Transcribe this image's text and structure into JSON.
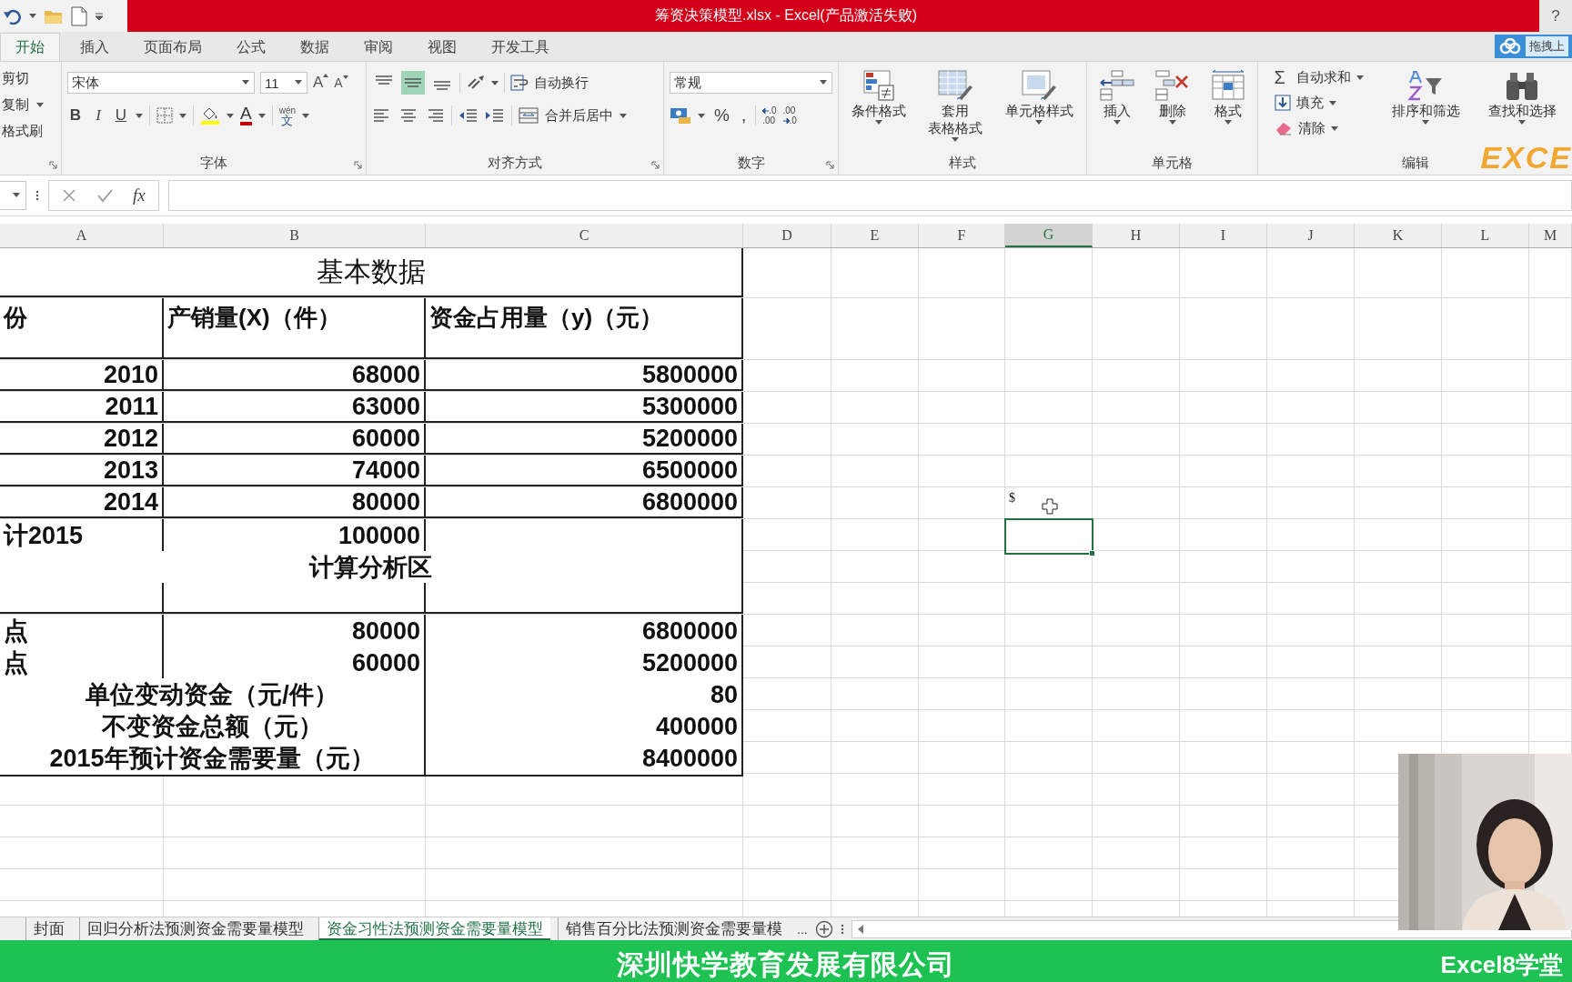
{
  "window": {
    "title": "筹资决策模型.xlsx -  Excel(产品激活失败)",
    "help": "?"
  },
  "cloud_badge": "拖拽上",
  "tabs": [
    {
      "label": "开始",
      "selected": true
    },
    {
      "label": "插入",
      "selected": false
    },
    {
      "label": "页面布局",
      "selected": false
    },
    {
      "label": "公式",
      "selected": false
    },
    {
      "label": "数据",
      "selected": false
    },
    {
      "label": "审阅",
      "selected": false
    },
    {
      "label": "视图",
      "selected": false
    },
    {
      "label": "开发工具",
      "selected": false
    }
  ],
  "ribbon": {
    "clipboard": [
      "剪切",
      "复制",
      "格式刷"
    ],
    "font": {
      "name": "宋体",
      "size": "11",
      "grow": "A",
      "shrink": "A",
      "styles": [
        "B",
        "I",
        "U"
      ],
      "color_letter": "A",
      "phonetic": [
        "wén",
        "文"
      ],
      "label": "字体"
    },
    "alignment": {
      "vertical": [
        {
          "selected": false
        },
        {
          "selected": true
        },
        {
          "selected": false
        }
      ],
      "wrap": "自动换行",
      "merge": "合并后居中",
      "label": "对齐方式"
    },
    "number": {
      "format": "常规",
      "percent": "%",
      "comma": ",",
      "decimals": [
        [
          ".0",
          ".00"
        ],
        [
          ".00",
          ".0"
        ]
      ],
      "label": "数字"
    },
    "styles": {
      "buttons": [
        [
          "条件格式"
        ],
        [
          "套用",
          "表格格式"
        ],
        [
          "单元格样式"
        ]
      ],
      "label": "样式"
    },
    "cells": {
      "buttons": [
        "插入",
        "删除",
        "格式"
      ],
      "label": "单元格"
    },
    "editing": {
      "sum_sign": "Σ",
      "autosum": "自动求和",
      "fill": "填充",
      "clear": "清除",
      "sort": "排序和筛选",
      "find": "查找和选择",
      "label": "编辑"
    },
    "logo": "EXCE"
  },
  "formula_bar": {
    "fx": "fx"
  },
  "columns": [
    {
      "label": "A",
      "selected": false
    },
    {
      "label": "B",
      "selected": false
    },
    {
      "label": "C",
      "selected": false
    },
    {
      "label": "D",
      "selected": false
    },
    {
      "label": "E",
      "selected": false
    },
    {
      "label": "F",
      "selected": false
    },
    {
      "label": "G",
      "selected": true
    },
    {
      "label": "H",
      "selected": false
    },
    {
      "label": "I",
      "selected": false
    },
    {
      "label": "J",
      "selected": false
    },
    {
      "label": "K",
      "selected": false
    },
    {
      "label": "L",
      "selected": false
    },
    {
      "label": "M",
      "selected": false
    }
  ],
  "rows": [
    {
      "kind": "title",
      "selected": false,
      "cells": [
        "基本数据"
      ]
    },
    {
      "kind": "header",
      "selected": false,
      "cells": [
        "份",
        "产销量(X)（件）",
        "资金占用量（y)（元）"
      ]
    },
    {
      "kind": "data",
      "selected": false,
      "cells": [
        "2010",
        "68000",
        "5800000"
      ]
    },
    {
      "kind": "data",
      "selected": false,
      "cells": [
        "2011",
        "63000",
        "5300000"
      ]
    },
    {
      "kind": "data",
      "selected": false,
      "cells": [
        "2012",
        "60000",
        "5200000"
      ]
    },
    {
      "kind": "data",
      "selected": false,
      "cells": [
        "2013",
        "74000",
        "6500000"
      ]
    },
    {
      "kind": "data",
      "selected": false,
      "cells": [
        "2014",
        "80000",
        "6800000"
      ]
    },
    {
      "kind": "forecast",
      "selected": true,
      "cells": [
        "计2015",
        "100000",
        ""
      ]
    },
    {
      "kind": "section",
      "selected": false,
      "cells": [
        "计算分析区"
      ]
    },
    {
      "kind": "blank",
      "selected": false,
      "cells": [
        "",
        "",
        ""
      ]
    },
    {
      "kind": "point",
      "selected": false,
      "cells": [
        "点",
        "80000",
        "6800000"
      ]
    },
    {
      "kind": "point",
      "selected": false,
      "cells": [
        "点",
        "60000",
        "5200000"
      ]
    },
    {
      "kind": "summary",
      "selected": false,
      "cells": [
        "单位变动资金（元/件）",
        "80"
      ]
    },
    {
      "kind": "summary",
      "selected": false,
      "cells": [
        "不变资金总额（元）",
        "400000"
      ]
    },
    {
      "kind": "summary",
      "selected": false,
      "cells": [
        "2015年预计资金需要量（元）",
        "8400000"
      ]
    }
  ],
  "cursor_label": "$",
  "sheet_tabs": [
    {
      "label": "封面",
      "selected": false
    },
    {
      "label": "回归分析法预测资金需要量模型",
      "selected": false
    },
    {
      "label": "资金习性法预测资金需要量模型",
      "selected": true
    },
    {
      "label": "销售百分比法预测资金需要量模",
      "selected": false
    }
  ],
  "sheet_more": "...",
  "banner": {
    "company": "深圳快学教育发展有限公司",
    "brand": "Excel8学堂"
  }
}
